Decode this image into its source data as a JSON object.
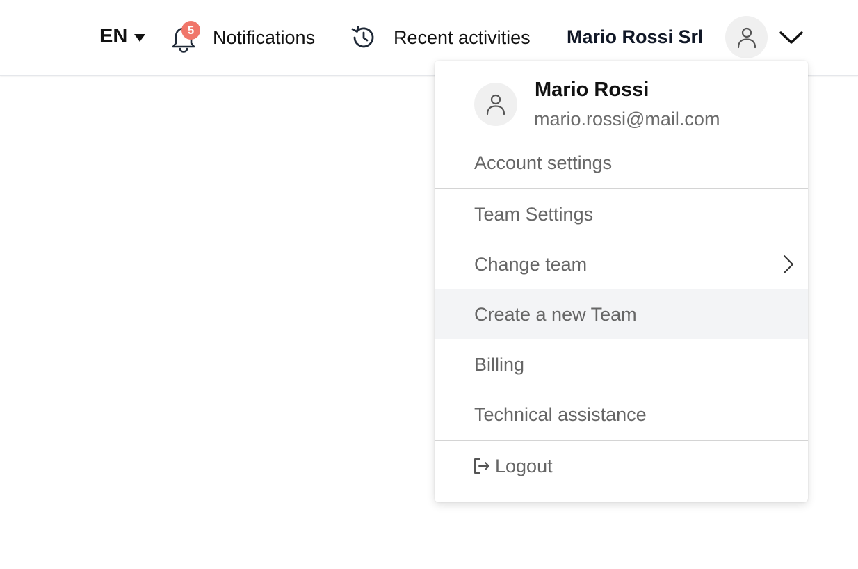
{
  "header": {
    "language": "EN",
    "notifications": {
      "label": "Notifications",
      "count": "5"
    },
    "recent_activities": {
      "label": "Recent activities"
    },
    "company": "Mario Rossi Srl"
  },
  "user_menu": {
    "name": "Mario Rossi",
    "email": "mario.rossi@mail.com",
    "account_settings": "Account settings",
    "team_settings": "Team Settings",
    "change_team": "Change team",
    "create_team": "Create a new Team",
    "billing": "Billing",
    "technical_assistance": "Technical assistance",
    "logout": "Logout"
  },
  "colors": {
    "badge": "#f0766a",
    "highlight": "#f3f4f6",
    "menu_text": "#666666"
  }
}
